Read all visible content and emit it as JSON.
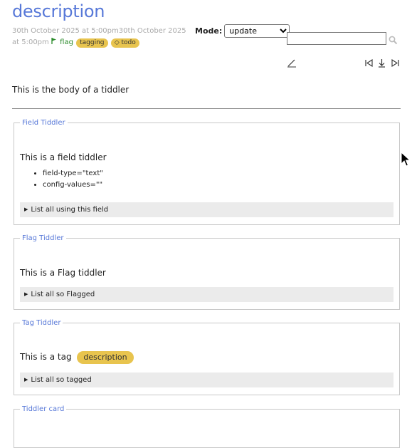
{
  "tiddler": {
    "title": "description",
    "subtitle_dates": "30th October 2025 at 5:00pm30th October 2025 at 5:00pm",
    "flag_label": "flag",
    "tags": [
      "tagging",
      "todo"
    ]
  },
  "mode": {
    "label": "Mode:",
    "selected": "update"
  },
  "search": {
    "value": "",
    "placeholder": ""
  },
  "toolbar": {
    "icons": [
      "edit-icon",
      "first-icon",
      "download-icon",
      "last-icon"
    ]
  },
  "body_text": "This is the body of a tiddler",
  "cards": {
    "field": {
      "legend": "Field Tiddler",
      "title": "This is a field tiddler",
      "items": [
        "field-type=\"text\"",
        "config-values=\"\""
      ],
      "details": "List all using this field"
    },
    "flag": {
      "legend": "Flag Tiddler",
      "title": "This is a Flag tiddler",
      "details": "List all so Flagged"
    },
    "tag": {
      "legend": "Tag Tiddler",
      "title": "This is a tag",
      "tag": "description",
      "details": "List all so tagged"
    },
    "tiddlercard": {
      "legend": "Tiddler card"
    }
  },
  "colors": {
    "title": "#5778d8",
    "tag": "#e8c44e",
    "flag": "#2a8a2a",
    "details_bg": "#ebebeb"
  }
}
